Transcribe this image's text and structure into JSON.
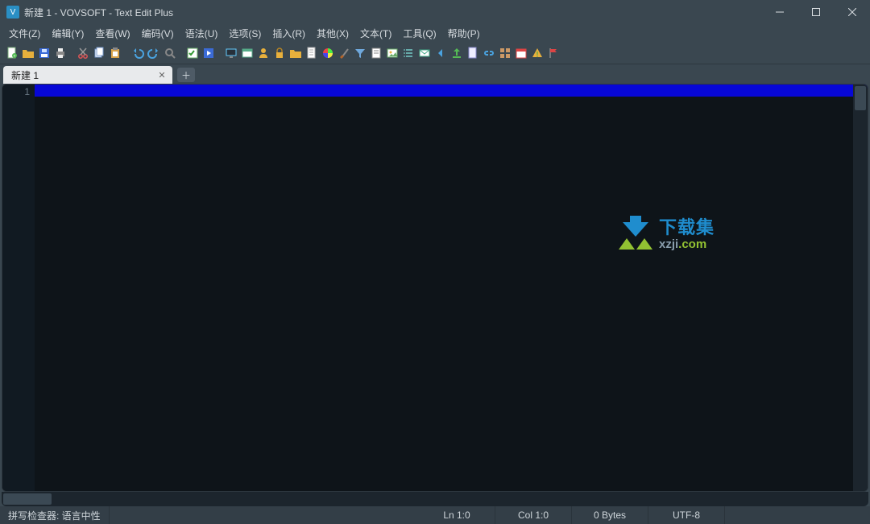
{
  "window": {
    "title": "新建 1 - VOVSOFT - Text Edit Plus"
  },
  "menu": {
    "items": [
      "文件(Z)",
      "编辑(Y)",
      "查看(W)",
      "编码(V)",
      "语法(U)",
      "选项(S)",
      "插入(R)",
      "其他(X)",
      "文本(T)",
      "工具(Q)",
      "帮助(P)"
    ]
  },
  "toolbar": {
    "icons": [
      "new-file-icon",
      "open-folder-icon",
      "save-icon",
      "print-icon",
      "sep",
      "cut-icon",
      "copy-icon",
      "paste-icon",
      "sep",
      "undo-icon",
      "redo-icon",
      "search-icon",
      "sep",
      "checklist-icon",
      "run-icon",
      "sep",
      "monitor-icon",
      "window-icon",
      "user-icon",
      "lock-icon",
      "folder-yellow-icon",
      "page-icon",
      "color-wheel-icon",
      "brush-icon",
      "funnel-icon",
      "doc-icon",
      "image-icon",
      "list-icon",
      "mail-icon",
      "arrow-left-icon",
      "upload-icon",
      "page2-icon",
      "link-icon",
      "grid-icon",
      "calendar-icon",
      "warning-icon",
      "flag-icon"
    ]
  },
  "tabs": {
    "active": {
      "label": "新建 1"
    }
  },
  "editor": {
    "gutter_first_line": "1"
  },
  "watermark": {
    "line1": "下载集",
    "line2_plain": "xzji",
    "line2_accent": ".com"
  },
  "status": {
    "spell": "拼写检查器: 语言中性",
    "ln": "Ln 1:0",
    "col": "Col 1:0",
    "bytes": "0 Bytes",
    "enc": "UTF-8"
  }
}
